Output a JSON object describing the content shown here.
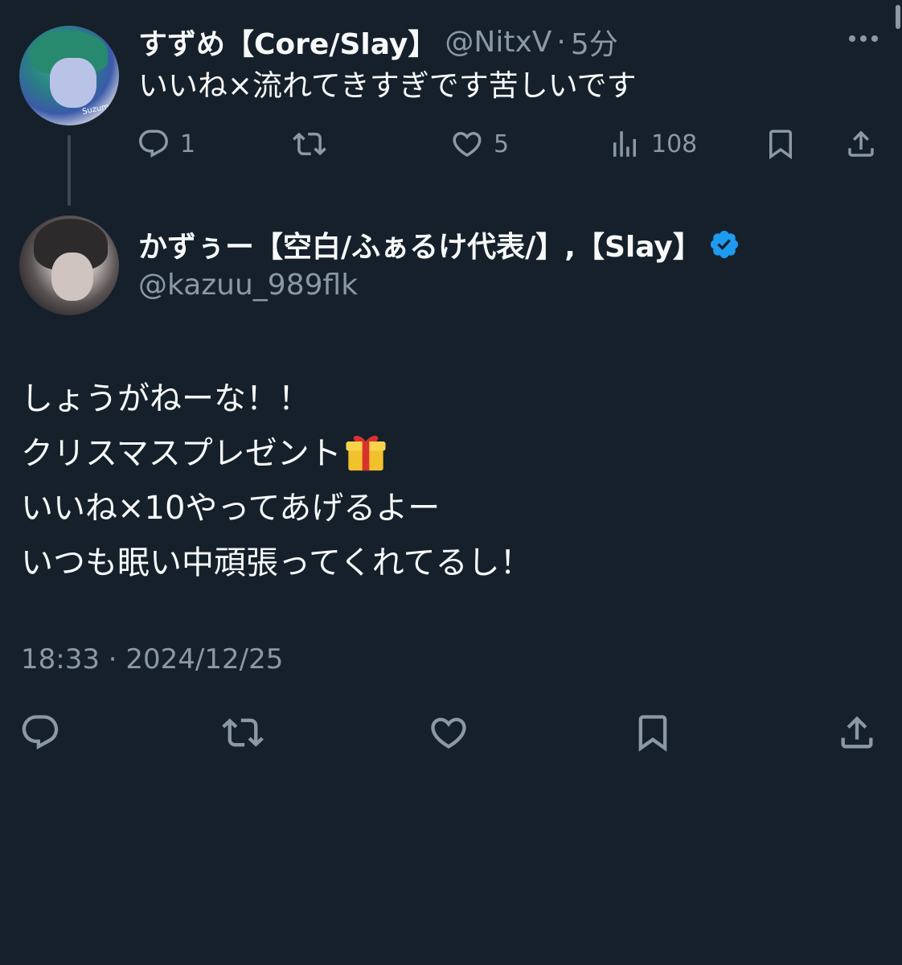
{
  "parent_tweet": {
    "display_name": "すずめ【Core/Slay】",
    "handle": "@NitxV",
    "separator": "·",
    "time_ago": "5分",
    "text": "いいね×流れてきすぎです苦しいです",
    "avatar_caption": "Suzume",
    "reply_count": "1",
    "like_count": "5",
    "view_count": "108"
  },
  "main_tweet": {
    "display_name": "かずぅー【空白/ふぁるけ代表/】,【Slay】",
    "handle": "@kazuu_989flk",
    "lines": [
      "しょうがねーな！！",
      "クリスマスプレゼント",
      "いいね×10やってあげるよー",
      "いつも眠い中頑張ってくれてるし！"
    ],
    "timestamp": "18:33 · 2024/12/25"
  },
  "colors": {
    "background": "#15202b",
    "text": "#f7f9f9",
    "secondary": "#8b98a5",
    "verified": "#1d9bf0"
  },
  "icons": [
    "reply-icon",
    "retweet-icon",
    "like-icon",
    "views-icon",
    "bookmark-icon",
    "share-icon",
    "verified-badge-icon",
    "gift-emoji-icon",
    "more-icon"
  ]
}
